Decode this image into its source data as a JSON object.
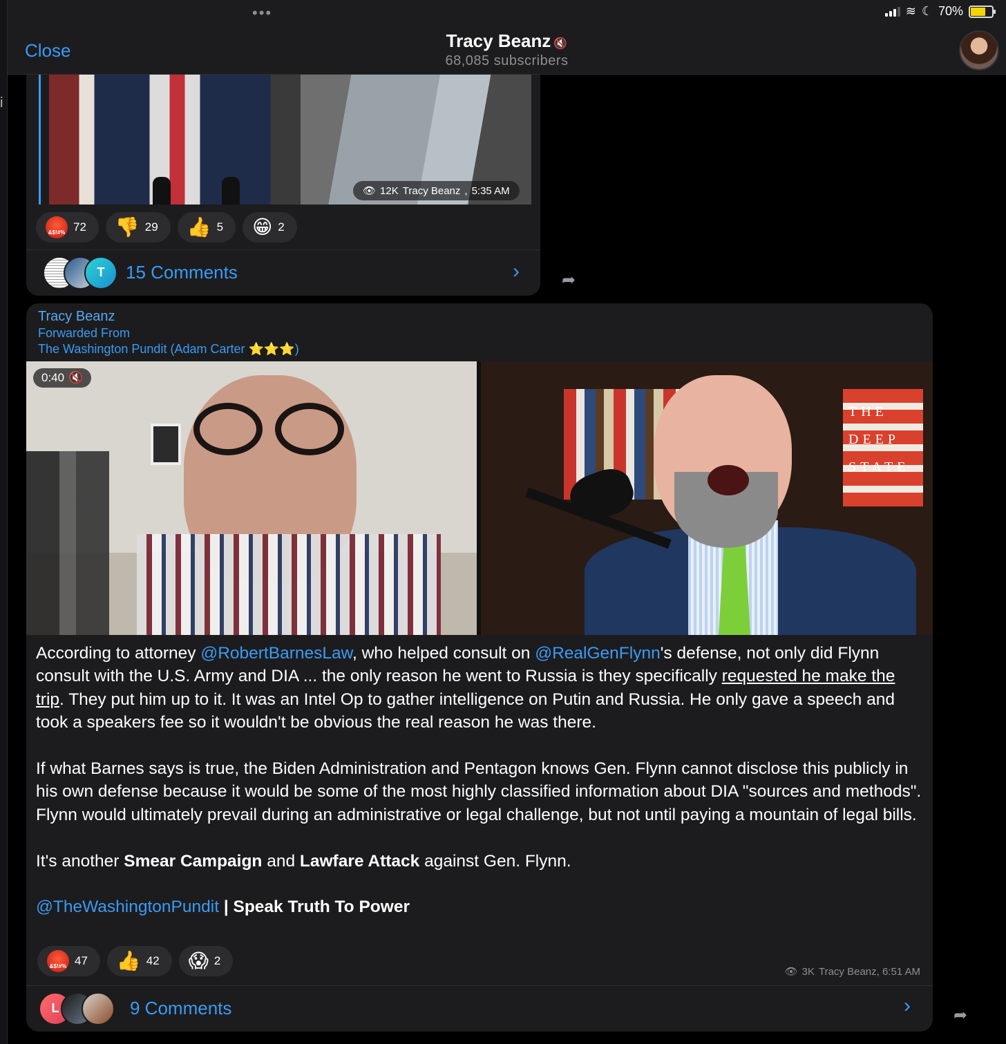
{
  "status_bar": {
    "battery_percent": "70%",
    "battery_level": 0.7
  },
  "header": {
    "close_label": "Close",
    "channel_name": "Tracy Beanz",
    "subscribers": "68,085 subscribers"
  },
  "post1": {
    "views": "12K",
    "author": "Tracy Beanz",
    "time": "5:35 AM",
    "reactions": [
      {
        "emoji": "&$!#%",
        "icon": "angry-face-icon",
        "count": "72"
      },
      {
        "emoji": "👎",
        "icon": "thumbs-down-icon",
        "count": "29"
      },
      {
        "emoji": "👍",
        "icon": "thumbs-up-icon",
        "count": "5"
      },
      {
        "emoji": "😁",
        "icon": "grinning-face-icon",
        "count": "2"
      }
    ],
    "comments_avatars": [
      "document-thumbnail",
      "photo-thumbnail",
      "T"
    ],
    "comments_label": "15 Comments"
  },
  "post2": {
    "author": "Tracy Beanz",
    "forwarded_label": "Forwarded From",
    "forwarded_source": "The Washington Pundit (Adam Carter ⭐️⭐️⭐️)",
    "video_duration": "0:40",
    "text": {
      "p1_a": "According to attorney ",
      "mention1": "@RobertBarnesLaw",
      "p1_b": ", who helped consult on ",
      "mention2": "@RealGenFlynn",
      "p1_c": "'s defense, not only did Flynn consult with the U.S. Army and DIA ... the only reason he went to Russia is they specifically ",
      "link1": "requested he make the trip",
      "p1_d": ". They put him up to it. It was an Intel Op to gather intelligence on Putin and Russia. He only gave a speech and took a speakers fee so it wouldn't be obvious the real reason he was there.",
      "p2": "If what Barnes says is true, the Biden Administration and Pentagon knows Gen. Flynn cannot disclose this publicly in his own defense because it would be some of the most highly classified information about DIA \"sources and methods\". Flynn would ultimately prevail during an administrative or legal challenge, but not until paying a mountain of legal bills.",
      "p3_a": "It's another ",
      "p3_b1": "Smear Campaign",
      "p3_c": " and ",
      "p3_b2": "Lawfare Attack",
      "p3_d": " against Gen. Flynn.",
      "mention3": "@TheWashingtonPundit",
      "p4_bold": " | Speak Truth To Power"
    },
    "reactions": [
      {
        "emoji": "&$!#%",
        "icon": "angry-face-icon",
        "count": "47"
      },
      {
        "emoji": "👍",
        "icon": "thumbs-up-icon",
        "count": "42"
      },
      {
        "emoji": "😱",
        "icon": "screaming-face-icon",
        "count": "2"
      }
    ],
    "views": "3K",
    "time": "Tracy Beanz, 6:51 AM",
    "comments_avatars": [
      "L",
      "photo-thumbnail",
      "photo-thumbnail"
    ],
    "comments_label": "9 Comments"
  },
  "colors": {
    "accent": "#3a9bf4",
    "bubble": "#1c1c1e",
    "background": "#000000"
  }
}
